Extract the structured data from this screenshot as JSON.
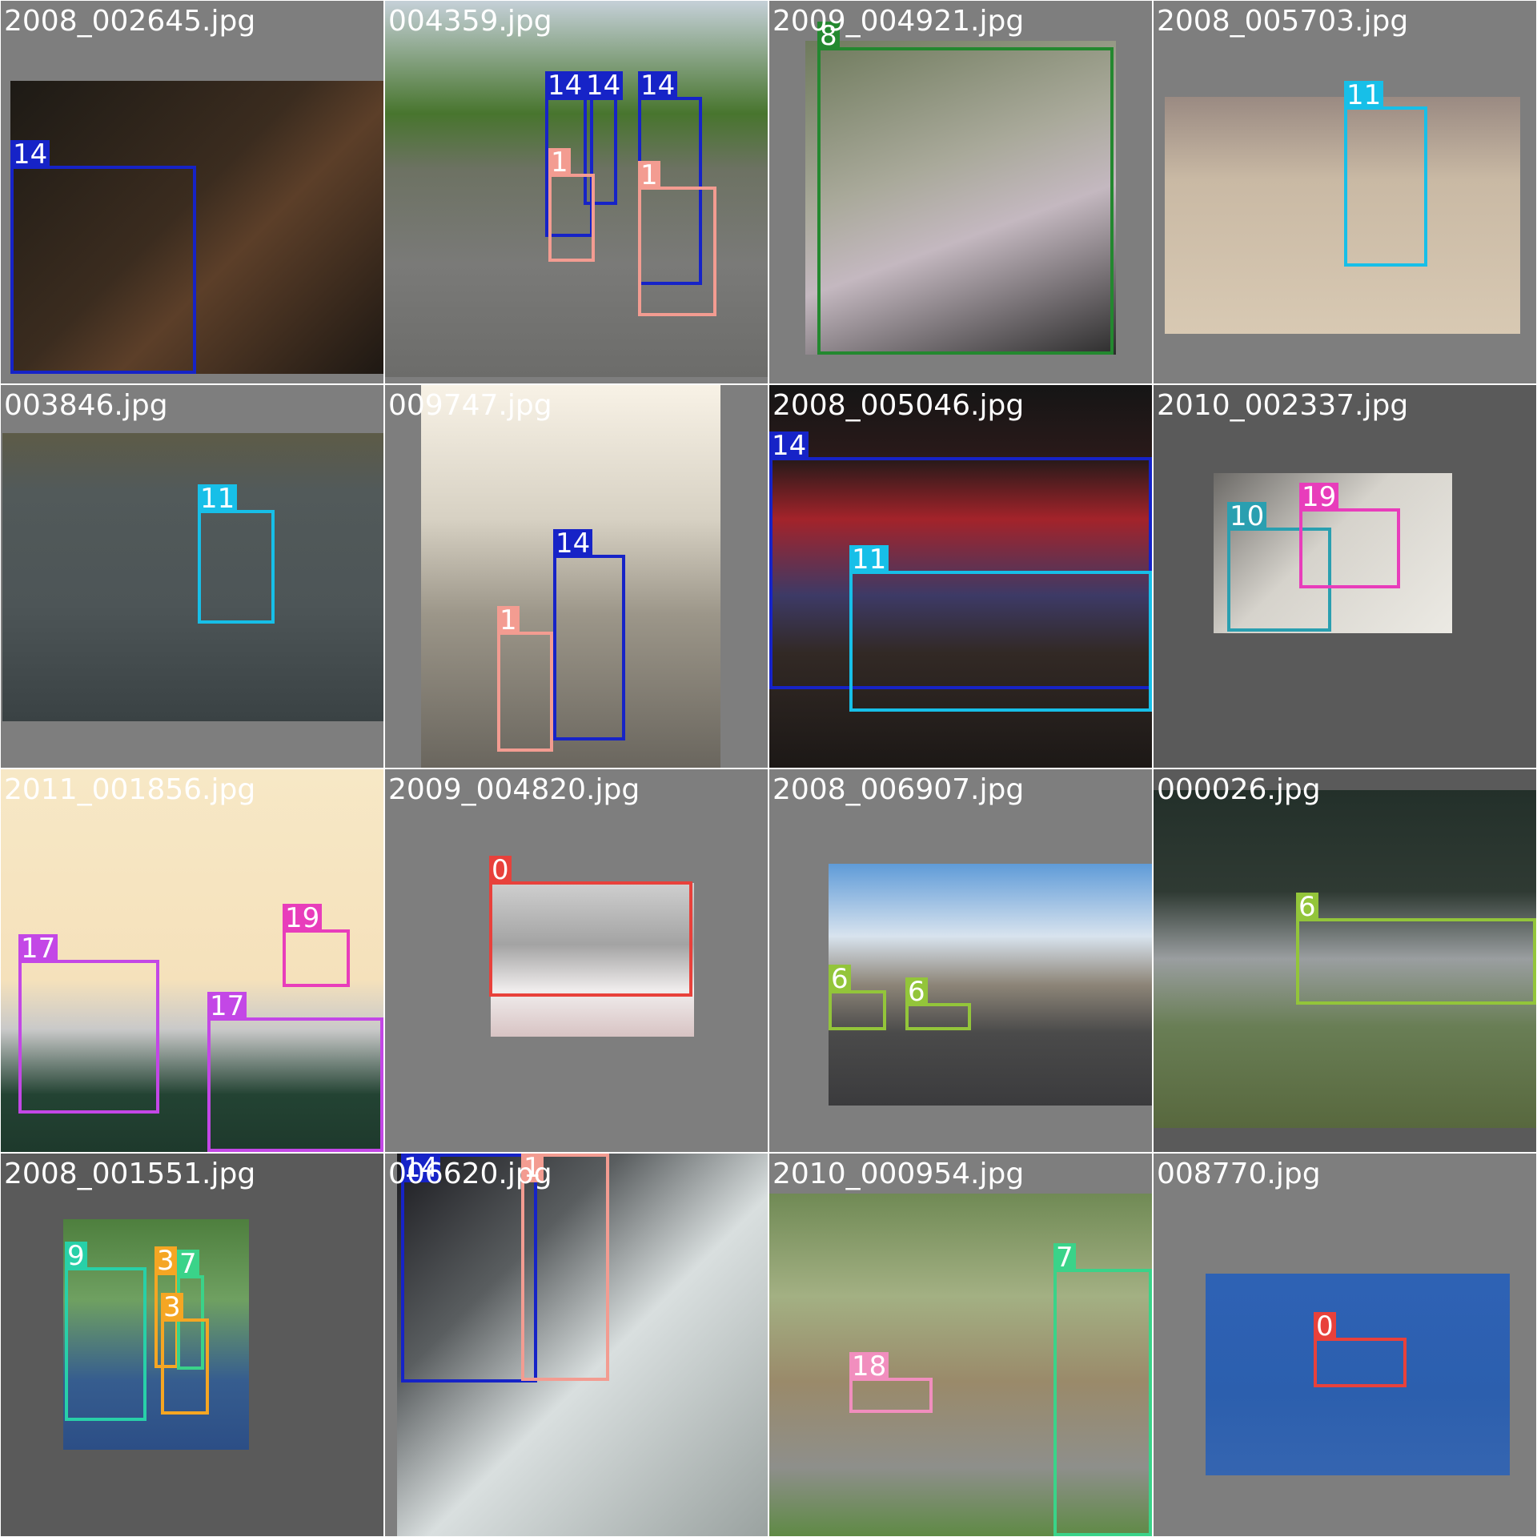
{
  "grid_images": [
    {
      "filename": "2008_002645.jpg",
      "labels": [
        "14"
      ]
    },
    {
      "filename": "004359.jpg",
      "labels": [
        "14",
        "14",
        "14",
        "1",
        "1"
      ]
    },
    {
      "filename": "2009_004921.jpg",
      "labels": [
        "8"
      ]
    },
    {
      "filename": "2008_005703.jpg",
      "labels": [
        "11"
      ]
    },
    {
      "filename": "003846.jpg",
      "labels": [
        "11"
      ]
    },
    {
      "filename": "009747.jpg",
      "labels": [
        "14",
        "1"
      ]
    },
    {
      "filename": "2008_005046.jpg",
      "labels": [
        "14",
        "11"
      ]
    },
    {
      "filename": "2010_002337.jpg",
      "labels": [
        "10",
        "19"
      ]
    },
    {
      "filename": "2011_001856.jpg",
      "labels": [
        "19",
        "17",
        "17"
      ]
    },
    {
      "filename": "2009_004820.jpg",
      "labels": [
        "0"
      ]
    },
    {
      "filename": "2008_006907.jpg",
      "labels": [
        "6",
        "6"
      ]
    },
    {
      "filename": "000026.jpg",
      "labels": [
        "6"
      ]
    },
    {
      "filename": "2008_001551.jpg",
      "labels": [
        "9",
        "3",
        "7",
        "3"
      ]
    },
    {
      "filename": "006620.jpg",
      "labels": [
        "14",
        "1"
      ]
    },
    {
      "filename": "2010_000954.jpg",
      "labels": [
        "7",
        "18"
      ]
    },
    {
      "filename": "008770.jpg",
      "labels": [
        "0"
      ]
    }
  ],
  "class_colors": {
    "0": "#e8413b",
    "1": "#f39c91",
    "3": "#f5a623",
    "6": "#93c53a",
    "7": "#3ad389",
    "8": "#23882f",
    "9": "#28d0a8",
    "10": "#2a9fb0",
    "11": "#17bfe8",
    "14": "#1623c7",
    "17": "#c347e6",
    "18": "#f18ebe",
    "19": "#e83dbb"
  }
}
